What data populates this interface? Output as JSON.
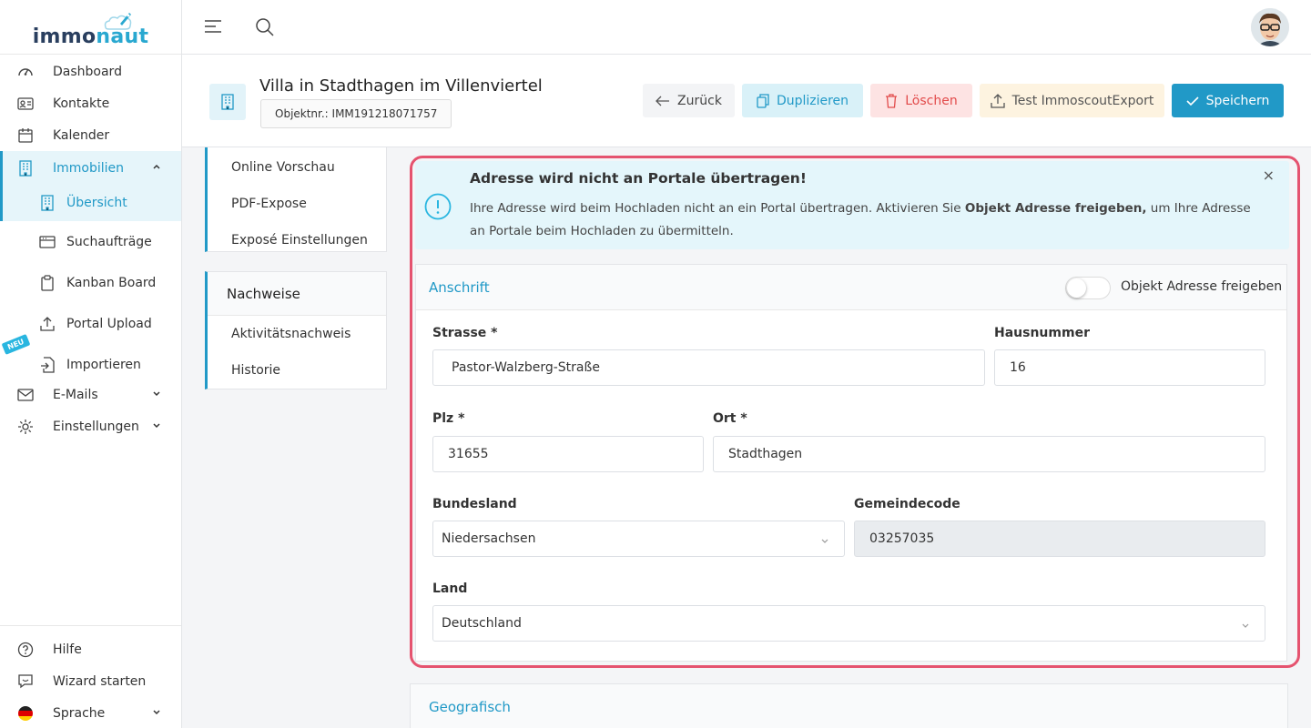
{
  "logo": {
    "part1": "immo",
    "part2": "naut"
  },
  "sidebar": {
    "dashboard": "Dashboard",
    "kontakte": "Kontakte",
    "kalender": "Kalender",
    "immobilien": "Immobilien",
    "uebersicht": "Übersicht",
    "suchauftraege": "Suchaufträge",
    "kanban": "Kanban Board",
    "portal_upload": "Portal Upload",
    "importieren": "Importieren",
    "neu_badge": "NEU",
    "emails": "E-Mails",
    "einstellungen": "Einstellungen",
    "hilfe": "Hilfe",
    "wizard": "Wizard starten",
    "sprache": "Sprache"
  },
  "header": {
    "title": "Villa in Stadthagen im Villenviertel",
    "objektnr": "Objektnr.: IMM191218071757",
    "back": "Zurück",
    "duplicate": "Duplizieren",
    "delete": "Löschen",
    "test_export": "Test ImmoscoutExport",
    "save": "Speichern"
  },
  "leftnav": {
    "items": [
      "Online Vorschau",
      "PDF-Expose",
      "Exposé Einstellungen"
    ],
    "nachweise_title": "Nachweise",
    "nachweise_items": [
      "Aktivitätsnachweis",
      "Historie"
    ]
  },
  "alert": {
    "title": "Adresse wird nicht an Portale übertragen!",
    "text1": "Ihre Adresse wird beim Hochladen nicht an ein Portal übertragen. Aktivieren Sie ",
    "text_bold": "Objekt Adresse freigeben,",
    "text2": " um Ihre Adresse an Portale beim Hochladen zu übermitteln.",
    "close": "×"
  },
  "anschrift": {
    "title": "Anschrift",
    "toggle_label": "Objekt Adresse freigeben",
    "toggle_on": false,
    "strasse_label": "Strasse *",
    "strasse": "Pastor-Walzberg-Straße",
    "hausnummer_label": "Hausnummer",
    "hausnummer": "16",
    "plz_label": "Plz *",
    "plz": "31655",
    "ort_label": "Ort *",
    "ort": "Stadthagen",
    "bundesland_label": "Bundesland",
    "bundesland": "Niedersachsen",
    "gemeindecode_label": "Gemeindecode",
    "gemeindecode": "03257035",
    "land_label": "Land",
    "land": "Deutschland"
  },
  "geografisch": {
    "title": "Geografisch"
  },
  "colors": {
    "accent": "#2199c7",
    "danger": "#e5536f",
    "alert_bg": "#e4f6fb"
  }
}
